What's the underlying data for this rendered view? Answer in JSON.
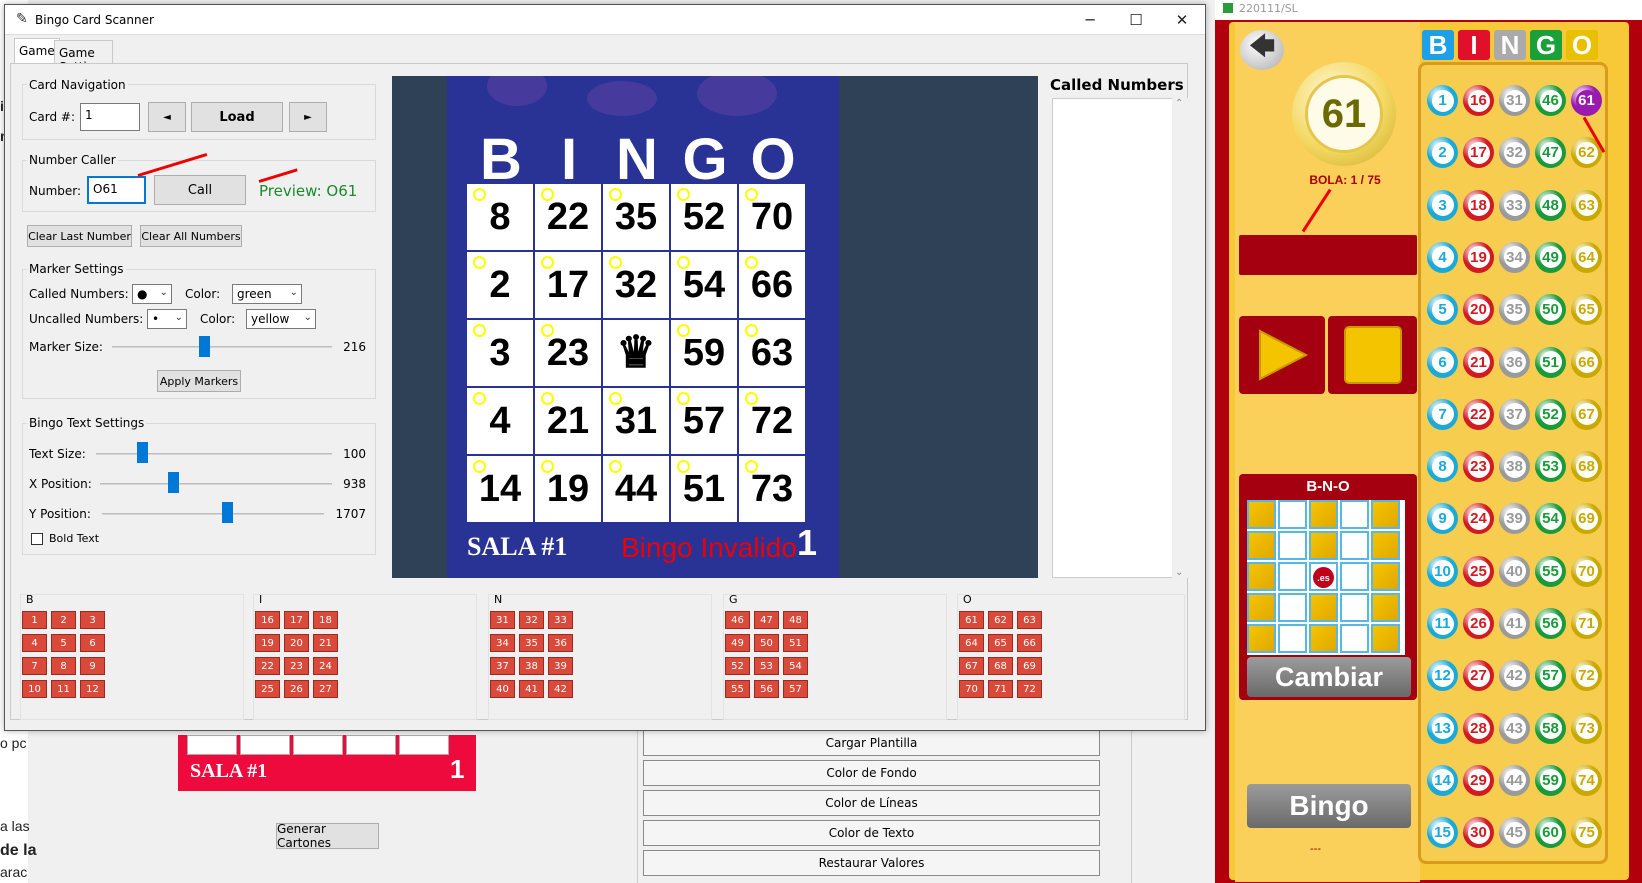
{
  "window": {
    "title": "Bingo Card Scanner",
    "controls": [
      "─",
      "☐",
      "✕"
    ]
  },
  "tabs": [
    "Game",
    "Game Settings"
  ],
  "card_navigation": {
    "title": "Card Navigation",
    "card_label": "Card #:",
    "card_value": "1",
    "prev": "◄",
    "load": "Load",
    "next": "►"
  },
  "number_caller": {
    "title": "Number Caller",
    "number_label": "Number:",
    "number_value": "O61",
    "call": "Call",
    "preview": "Preview: O61"
  },
  "clear": {
    "last": "Clear Last Number",
    "all": "Clear All Numbers"
  },
  "marker_settings": {
    "title": "Marker Settings",
    "called_label": "Called Numbers:",
    "called_marker": "●",
    "color_label": "Color:",
    "called_color": "green",
    "uncalled_label": "Uncalled Numbers:",
    "uncalled_marker": "•",
    "uncalled_color": "yellow",
    "size_label": "Marker Size:",
    "size_value": "216",
    "apply": "Apply Markers"
  },
  "bingo_text": {
    "title": "Bingo Text Settings",
    "text_size_label": "Text Size:",
    "text_size_value": "100",
    "x_label": "X Position:",
    "x_value": "938",
    "y_label": "Y Position:",
    "y_value": "1707",
    "bold_label": "Bold Text"
  },
  "card": {
    "letters": [
      "B",
      "I",
      "N",
      "G",
      "O"
    ],
    "rows": [
      [
        "8",
        "22",
        "35",
        "52",
        "70"
      ],
      [
        "2",
        "17",
        "32",
        "54",
        "66"
      ],
      [
        "3",
        "23",
        "♛",
        "59",
        "63"
      ],
      [
        "4",
        "21",
        "31",
        "57",
        "72"
      ],
      [
        "14",
        "19",
        "44",
        "51",
        "73"
      ]
    ],
    "sala": "SALA #1",
    "invalid": "Bingo Invalido",
    "number": "1"
  },
  "called_numbers_title": "Called Numbers",
  "number_board": {
    "columns": [
      {
        "letter": "B",
        "numbers": [
          "1",
          "2",
          "3",
          "4",
          "5",
          "6",
          "7",
          "8",
          "9",
          "10",
          "11",
          "12",
          "13",
          "14",
          "15"
        ]
      },
      {
        "letter": "I",
        "numbers": [
          "16",
          "17",
          "18",
          "19",
          "20",
          "21",
          "22",
          "23",
          "24",
          "25",
          "26",
          "27",
          "28",
          "29",
          "30"
        ]
      },
      {
        "letter": "N",
        "numbers": [
          "31",
          "32",
          "33",
          "34",
          "35",
          "36",
          "37",
          "38",
          "39",
          "40",
          "41",
          "42",
          "43",
          "44",
          "45"
        ]
      },
      {
        "letter": "G",
        "numbers": [
          "46",
          "47",
          "48",
          "49",
          "50",
          "51",
          "52",
          "53",
          "54",
          "55",
          "56",
          "57",
          "58",
          "59",
          "60"
        ]
      },
      {
        "letter": "O",
        "numbers": [
          "61",
          "62",
          "63",
          "64",
          "65",
          "66",
          "67",
          "68",
          "69",
          "70",
          "71",
          "72",
          "73",
          "74",
          "75"
        ]
      }
    ]
  },
  "background_app": {
    "fragments": [
      "i",
      "n",
      "o pc",
      "a las",
      "de la",
      "arac"
    ],
    "ticket_sala": "SALA #1",
    "ticket_num": "1",
    "generar": "Generar Cartones",
    "buttons": [
      "Cargar Plantilla",
      "Color de Fondo",
      "Color de Líneas",
      "Color de Texto",
      "Restaurar Valores"
    ]
  },
  "bingo_app": {
    "title_fragment": "220111/SL",
    "back": "🡄",
    "current_ball": "61",
    "bola": "BOLA: 1 / 75",
    "pattern_title": "B-N-O",
    "pattern_center": ".es",
    "cambiar": "Cambiar",
    "bingo": "Bingo",
    "dashes": "---",
    "logo": [
      "B",
      "I",
      "N",
      "G",
      "O"
    ],
    "logo_colors": [
      "#1ea0e6",
      "#e0102a",
      "#aaaaaa",
      "#1aa03a",
      "#e8c000"
    ],
    "ball_colors": [
      "#1aa9d8",
      "#d21a22",
      "#9a9a9a",
      "#1a9a3a",
      "#c9a900"
    ],
    "highlight_ball": "61",
    "highlight_color": "#9a1ab0",
    "balls": [
      [
        "1",
        "16",
        "31",
        "46",
        "61"
      ],
      [
        "2",
        "17",
        "32",
        "47",
        "62"
      ],
      [
        "3",
        "18",
        "33",
        "48",
        "63"
      ],
      [
        "4",
        "19",
        "34",
        "49",
        "64"
      ],
      [
        "5",
        "20",
        "35",
        "50",
        "65"
      ],
      [
        "6",
        "21",
        "36",
        "51",
        "66"
      ],
      [
        "7",
        "22",
        "37",
        "52",
        "67"
      ],
      [
        "8",
        "23",
        "38",
        "53",
        "68"
      ],
      [
        "9",
        "24",
        "39",
        "54",
        "69"
      ],
      [
        "10",
        "25",
        "40",
        "55",
        "70"
      ],
      [
        "11",
        "26",
        "41",
        "56",
        "71"
      ],
      [
        "12",
        "27",
        "42",
        "57",
        "72"
      ],
      [
        "13",
        "28",
        "43",
        "58",
        "73"
      ],
      [
        "14",
        "29",
        "44",
        "59",
        "74"
      ],
      [
        "15",
        "30",
        "45",
        "60",
        "75"
      ]
    ]
  }
}
